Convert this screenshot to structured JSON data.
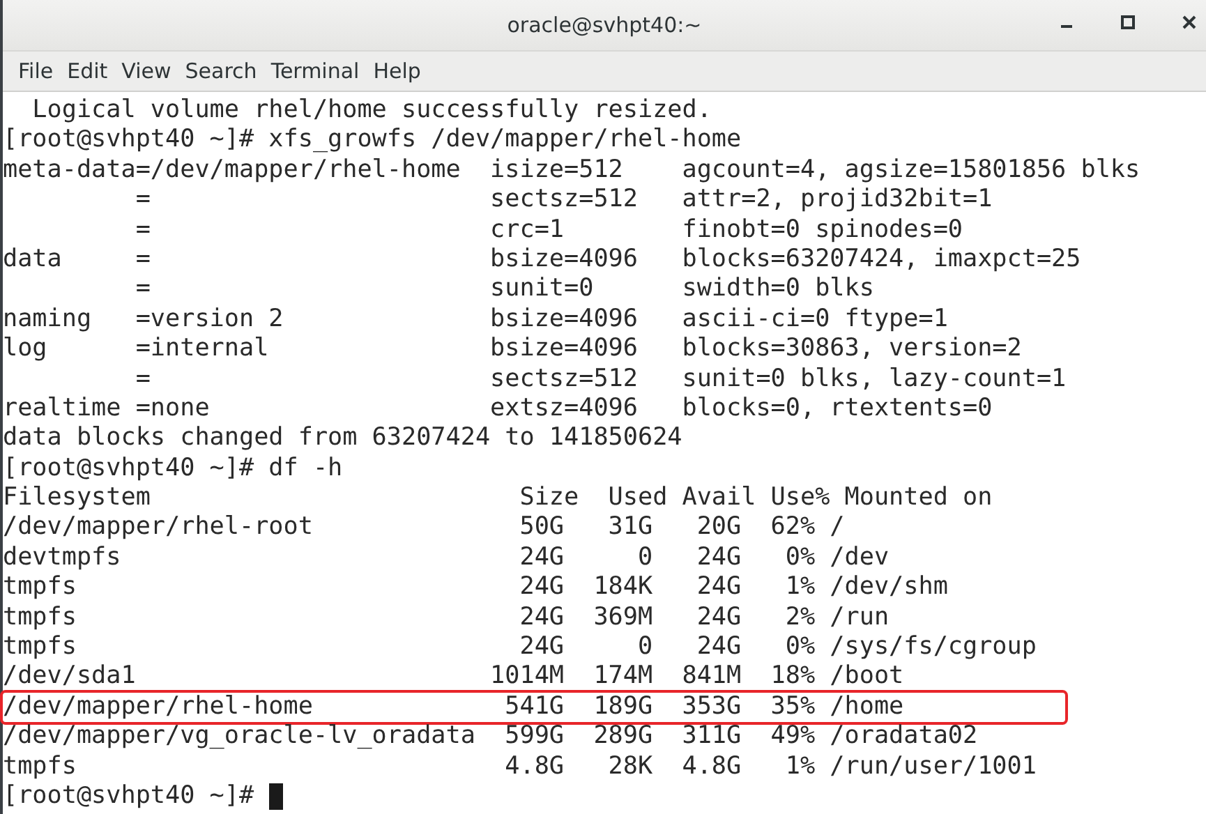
{
  "window": {
    "title": "oracle@svhpt40:~"
  },
  "menu": [
    "File",
    "Edit",
    "View",
    "Search",
    "Terminal",
    "Help"
  ],
  "terminal": {
    "cursor": true,
    "lines": [
      {
        "text": "  Logical volume rhel/home successfully resized.",
        "highlighted": false
      },
      {
        "text": "[root@svhpt40 ~]# xfs_growfs /dev/mapper/rhel-home",
        "highlighted": false
      },
      {
        "text": "meta-data=/dev/mapper/rhel-home  isize=512    agcount=4, agsize=15801856 blks",
        "highlighted": false
      },
      {
        "text": "         =                       sectsz=512   attr=2, projid32bit=1",
        "highlighted": false
      },
      {
        "text": "         =                       crc=1        finobt=0 spinodes=0",
        "highlighted": false
      },
      {
        "text": "data     =                       bsize=4096   blocks=63207424, imaxpct=25",
        "highlighted": false
      },
      {
        "text": "         =                       sunit=0      swidth=0 blks",
        "highlighted": false
      },
      {
        "text": "naming   =version 2              bsize=4096   ascii-ci=0 ftype=1",
        "highlighted": false
      },
      {
        "text": "log      =internal               bsize=4096   blocks=30863, version=2",
        "highlighted": false
      },
      {
        "text": "         =                       sectsz=512   sunit=0 blks, lazy-count=1",
        "highlighted": false
      },
      {
        "text": "realtime =none                   extsz=4096   blocks=0, rtextents=0",
        "highlighted": false
      },
      {
        "text": "data blocks changed from 63207424 to 141850624",
        "highlighted": false
      },
      {
        "text": "[root@svhpt40 ~]# df -h",
        "highlighted": false
      },
      {
        "text": "Filesystem                         Size  Used Avail Use% Mounted on",
        "highlighted": false
      },
      {
        "text": "/dev/mapper/rhel-root              50G   31G   20G  62% /",
        "highlighted": false
      },
      {
        "text": "devtmpfs                           24G     0   24G   0% /dev",
        "highlighted": false
      },
      {
        "text": "tmpfs                              24G  184K   24G   1% /dev/shm",
        "highlighted": false
      },
      {
        "text": "tmpfs                              24G  369M   24G   2% /run",
        "highlighted": false
      },
      {
        "text": "tmpfs                              24G     0   24G   0% /sys/fs/cgroup",
        "highlighted": false
      },
      {
        "text": "/dev/sda1                        1014M  174M  841M  18% /boot",
        "highlighted": false
      },
      {
        "text": "/dev/mapper/rhel-home             541G  189G  353G  35% /home",
        "highlighted": true
      },
      {
        "text": "/dev/mapper/vg_oracle-lv_oradata  599G  289G  311G  49% /oradata02",
        "highlighted": false
      },
      {
        "text": "tmpfs                             4.8G   28K  4.8G   1% /run/user/1001",
        "highlighted": false
      },
      {
        "text": "[root@svhpt40 ~]# ",
        "highlighted": false
      }
    ]
  }
}
